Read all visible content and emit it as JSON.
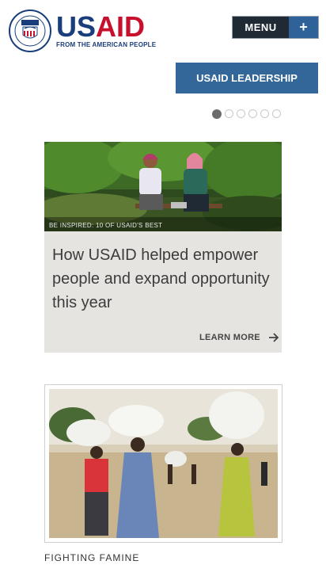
{
  "header": {
    "logo_us": "US",
    "logo_aid": "AID",
    "tagline": "FROM THE AMERICAN PEOPLE",
    "menu_label": "MENU",
    "menu_plus": "+"
  },
  "leadership_button": "USAID LEADERSHIP",
  "carousel": {
    "slides": 6,
    "active": 1
  },
  "feature": {
    "image_caption": "BE INSPIRED: 10 OF USAID'S BEST",
    "headline": "How USAID helped empower people and expand opportunity this year",
    "link_label": "LEARN MORE"
  },
  "story": {
    "label": "FIGHTING FAMINE"
  },
  "colors": {
    "brand_blue": "#1a3d7c",
    "brand_red": "#c8102e",
    "button_blue": "#336699",
    "menu_dark": "#1f2a35"
  }
}
